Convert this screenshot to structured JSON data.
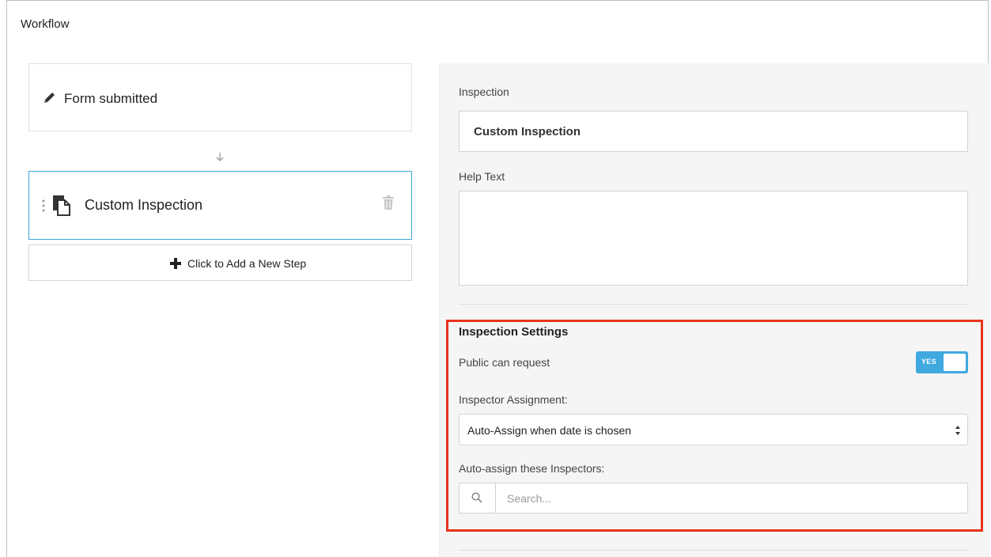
{
  "title": "Workflow",
  "steps": {
    "trigger_label": "Form submitted",
    "step_label": "Custom Inspection",
    "add_step_label": "Click to Add a New Step"
  },
  "panel": {
    "inspection_label": "Inspection",
    "inspection_value": "Custom Inspection",
    "help_text_label": "Help Text",
    "help_text_value": "",
    "settings": {
      "title": "Inspection Settings",
      "public_can_request_label": "Public can request",
      "public_toggle_text": "YES",
      "inspector_assignment_label": "Inspector Assignment:",
      "inspector_assignment_value": "Auto-Assign when date is chosen",
      "auto_assign_label": "Auto-assign these Inspectors:",
      "search_placeholder": "Search..."
    }
  },
  "colors": {
    "accent": "#3fa9e0",
    "highlight": "#e8341c",
    "selected_border": "#39a7d4"
  },
  "icons": [
    "pencil-icon",
    "arrow-down-icon",
    "drag-handle-icon",
    "document-icon",
    "trash-icon",
    "plus-icon",
    "select-arrows-icon",
    "search-icon"
  ]
}
